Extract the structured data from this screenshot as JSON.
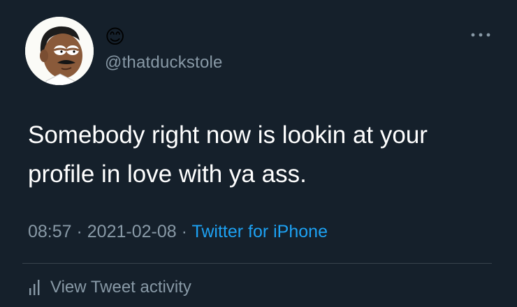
{
  "tweet": {
    "display_name_emoji": "😊",
    "handle": "@thatduckstole",
    "text_line1": "Somebody right now is lookin at your",
    "text_line2": "profile in love with ya ass.",
    "time": "08:57",
    "separator": " · ",
    "date": "2021-02-08",
    "source": "Twitter for iPhone",
    "activity_label": "View Tweet activity"
  },
  "icons": {
    "more": "more-horizontal-icon",
    "activity": "bar-chart-icon",
    "avatar": "cartoon-avatar"
  },
  "colors": {
    "background": "#15202b",
    "text": "#ffffff",
    "secondary": "#8899a6",
    "link": "#1da1f2",
    "divider": "#38444d"
  }
}
